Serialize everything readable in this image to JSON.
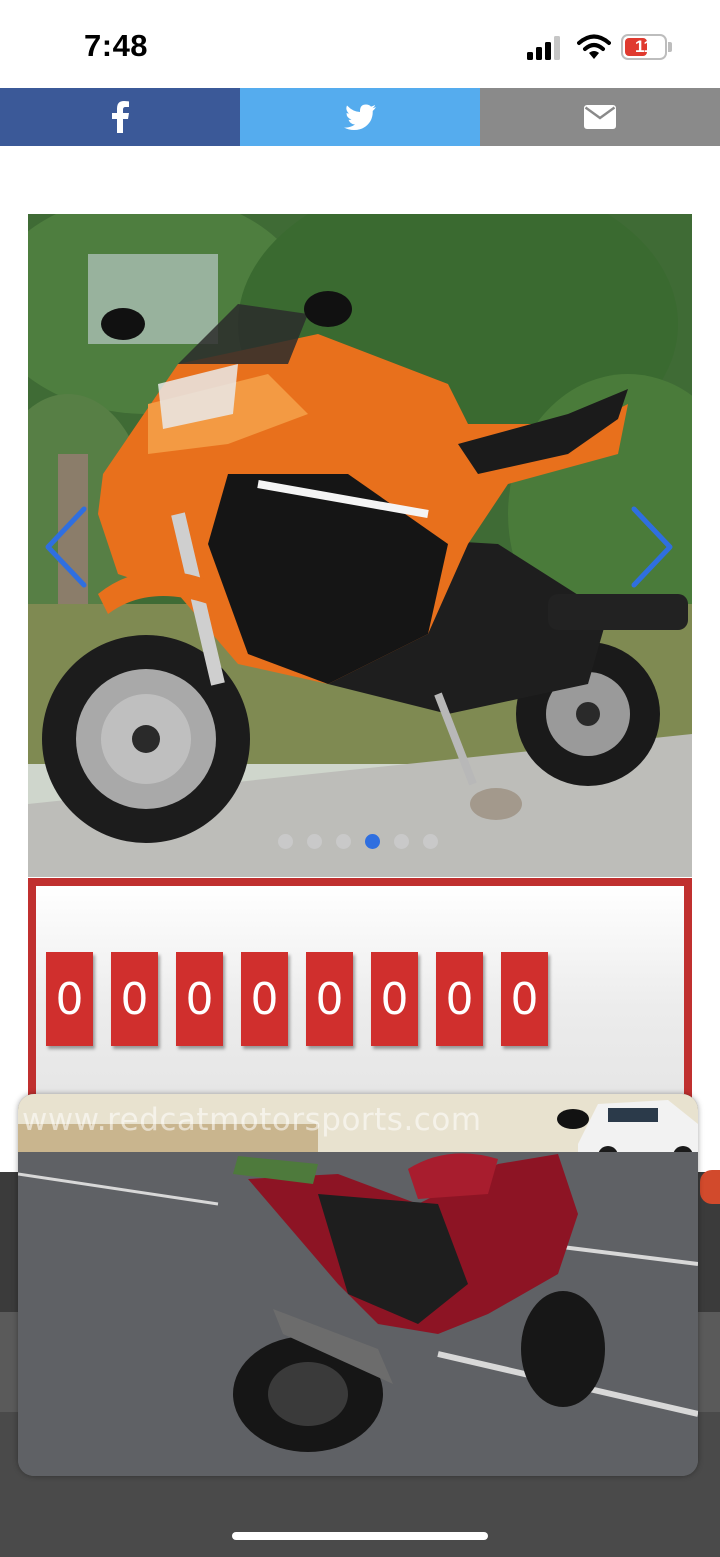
{
  "status_bar": {
    "time": "7:48",
    "battery_level": "11",
    "battery_color": "#e03a2f"
  },
  "share_bar": {
    "items": [
      {
        "icon": "facebook-icon",
        "color": "#3b5998"
      },
      {
        "icon": "twitter-icon",
        "color": "#55acee"
      },
      {
        "icon": "email-icon",
        "color": "#8a8a8a"
      }
    ]
  },
  "gallery": {
    "image": "orange-sport-motorcycle",
    "slide_count": 6,
    "active_slide": 4
  },
  "counter": {
    "digits": [
      "0",
      "0",
      "0",
      "0",
      "0",
      "0",
      "0",
      "0"
    ],
    "color": "#d02f2d"
  },
  "overlay_photo": {
    "image": "red-sport-motorcycle",
    "watermark": "www.redcatmotorsports.com"
  }
}
